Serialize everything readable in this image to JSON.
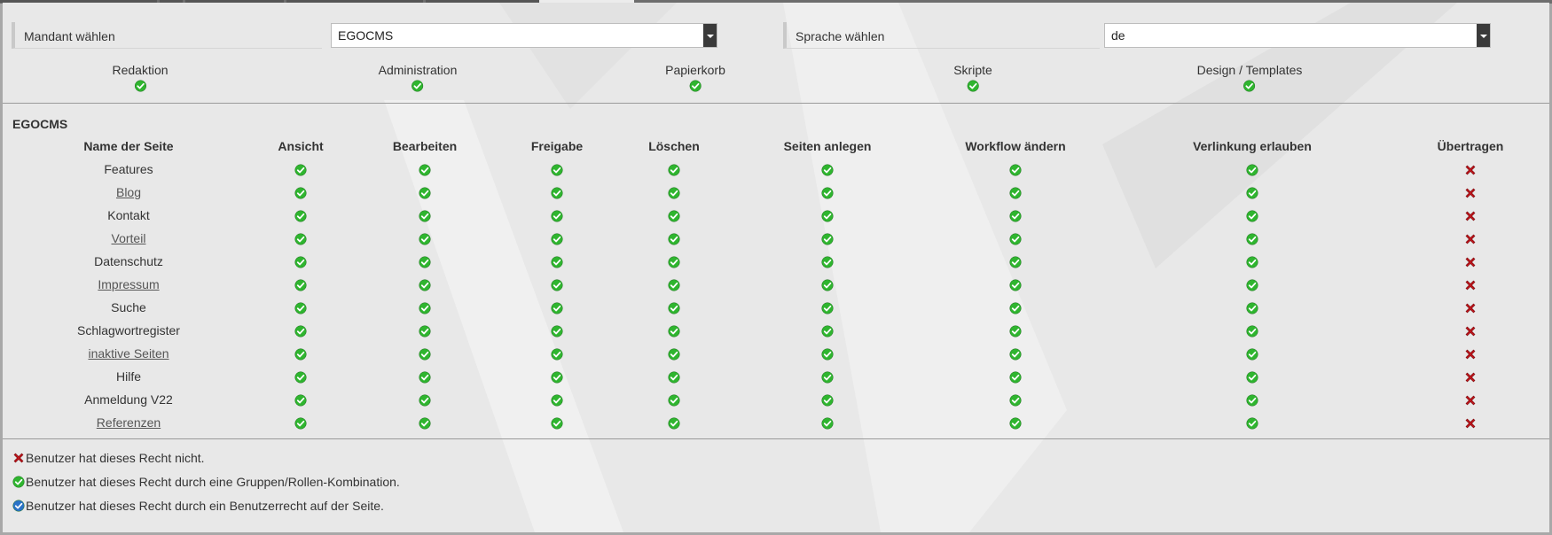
{
  "mandant": {
    "label": "Mandant wählen",
    "value": "EGOCMS"
  },
  "sprache": {
    "label": "Sprache wählen",
    "value": "de"
  },
  "global_permissions": [
    {
      "label": "Redaktion",
      "status": "group"
    },
    {
      "label": "Administration",
      "status": "group"
    },
    {
      "label": "Papierkorb",
      "status": "group"
    },
    {
      "label": "Skripte",
      "status": "group"
    },
    {
      "label": "Design / Templates",
      "status": "group"
    }
  ],
  "section_title": "EGOCMS",
  "columns": [
    "Name der Seite",
    "Ansicht",
    "Bearbeiten",
    "Freigabe",
    "Löschen",
    "Seiten anlegen",
    "Workflow ändern",
    "Verlinkung erlauben",
    "Übertragen"
  ],
  "pages": [
    {
      "name": "Features",
      "link": false
    },
    {
      "name": "Blog",
      "link": true
    },
    {
      "name": "Kontakt",
      "link": false
    },
    {
      "name": "Vorteil",
      "link": true
    },
    {
      "name": "Datenschutz",
      "link": false
    },
    {
      "name": "Impressum",
      "link": true
    },
    {
      "name": "Suche",
      "link": false
    },
    {
      "name": "Schlagwortregister",
      "link": false
    },
    {
      "name": "inaktive Seiten",
      "link": true
    },
    {
      "name": "Hilfe",
      "link": false
    },
    {
      "name": "Anmeldung V22",
      "link": false
    },
    {
      "name": "Referenzen",
      "link": true
    }
  ],
  "rights_pattern": [
    "group",
    "group",
    "group",
    "group",
    "group",
    "group",
    "group",
    "denied"
  ],
  "legend": [
    {
      "icon": "denied",
      "text": "Benutzer hat dieses Recht nicht."
    },
    {
      "icon": "group",
      "text": "Benutzer hat dieses Recht durch eine Gruppen/Rollen-Kombination."
    },
    {
      "icon": "user",
      "text": "Benutzer hat dieses Recht durch ein Benutzerrecht auf der Seite."
    }
  ],
  "colors": {
    "check_green": "#2fb52f",
    "cross_red": "#c0151b",
    "check_blue": "#2a73c8"
  }
}
